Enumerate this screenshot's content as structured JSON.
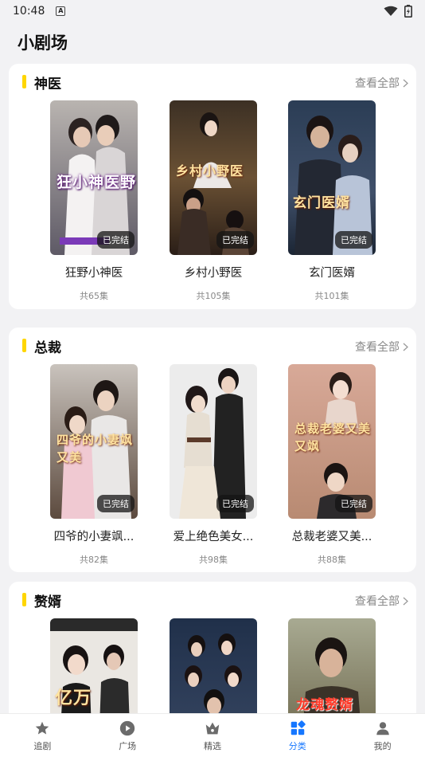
{
  "status_bar": {
    "time": "10:48",
    "a_badge": "A"
  },
  "page": {
    "title": "小剧场"
  },
  "sections": [
    {
      "title": "神医",
      "more": "查看全部",
      "dramas": [
        {
          "name": "狂野小神医",
          "count": "共65集",
          "badge": "已完结",
          "poster_text": "狂小神医野"
        },
        {
          "name": "乡村小野医",
          "count": "共105集",
          "badge": "已完结",
          "poster_text": "乡村小野医"
        },
        {
          "name": "玄门医婿",
          "count": "共101集",
          "badge": "已完结",
          "poster_text": "玄门医婿"
        }
      ]
    },
    {
      "title": "总裁",
      "more": "查看全部",
      "dramas": [
        {
          "name": "四爷的小妻飒...",
          "count": "共82集",
          "badge": "已完结",
          "poster_text": "四爷的小妻飒又美"
        },
        {
          "name": "爱上绝色美女...",
          "count": "共98集",
          "badge": "已完结",
          "poster_text": ""
        },
        {
          "name": "总裁老婆又美...",
          "count": "共88集",
          "badge": "已完结",
          "poster_text": "总裁老婆又美又飒"
        }
      ]
    },
    {
      "title": "赘婿",
      "more": "查看全部",
      "dramas": [
        {
          "poster_text": "亿万"
        },
        {
          "poster_text": ""
        },
        {
          "poster_text": "龙魂赘婿"
        }
      ]
    }
  ],
  "tabs": [
    {
      "label": "追剧",
      "icon": "star-icon",
      "active": false
    },
    {
      "label": "广场",
      "icon": "play-icon",
      "active": false
    },
    {
      "label": "精选",
      "icon": "crown-icon",
      "active": false
    },
    {
      "label": "分类",
      "icon": "category-icon",
      "active": true
    },
    {
      "label": "我的",
      "icon": "person-icon",
      "active": false
    }
  ],
  "colors": {
    "accent": "#1677ff",
    "section_bar": "#ffd600"
  }
}
